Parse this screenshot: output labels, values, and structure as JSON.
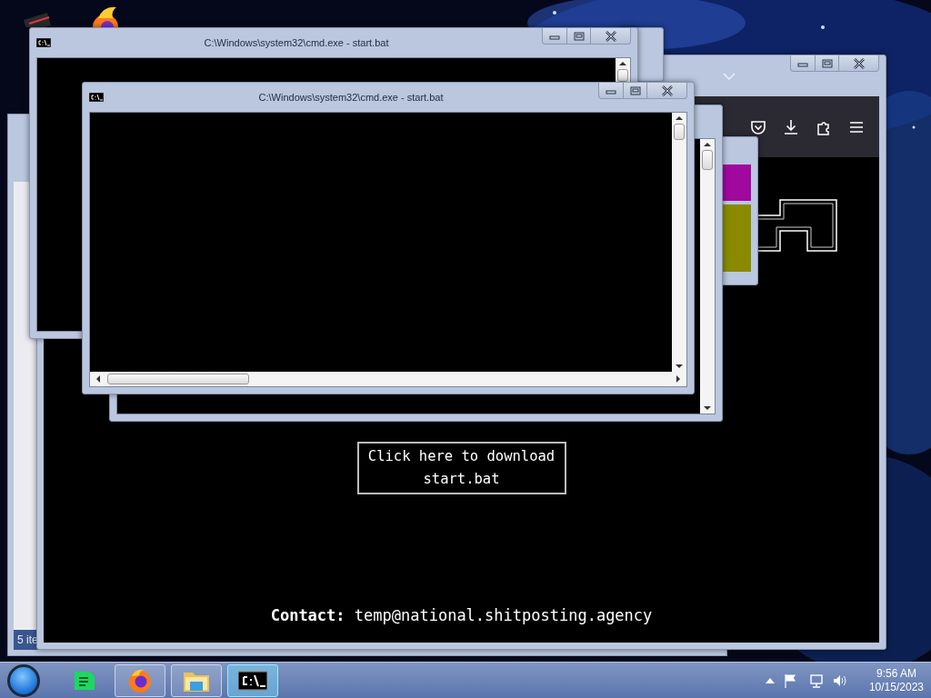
{
  "explorer_window": {
    "status": "5 ite"
  },
  "browser": {
    "download_button": "Click here to download start.bat",
    "contact": "**Contact:** temp@national.shitposting.agency"
  },
  "cmd_windows": [
    {
      "title": "C:\\Windows\\system32\\cmd.exe - start.bat"
    },
    {
      "title": "C:\\Windows\\system32\\cmd.exe - start.bat"
    }
  ],
  "taskbar": {
    "items": [
      {
        "kind": "chat",
        "selected": false
      },
      {
        "kind": "browser",
        "selected": false
      },
      {
        "kind": "folder",
        "selected": false
      },
      {
        "kind": "console",
        "selected": true
      }
    ],
    "clock": {
      "time": "9:56 AM",
      "date": "10/15/2023"
    }
  }
}
